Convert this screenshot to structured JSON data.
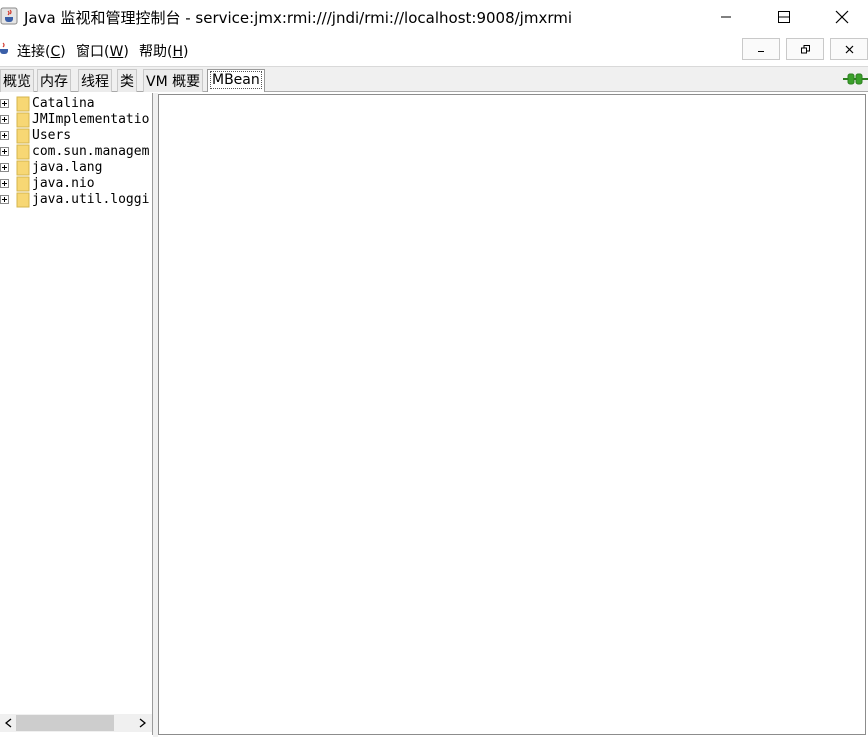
{
  "window": {
    "title": "Java 监视和管理控制台 - service:jmx:rmi:///jndi/rmi://localhost:9008/jmxrmi",
    "app_icon": "java-cup-icon",
    "controls": [
      "minimize-icon",
      "maximize-icon",
      "close-icon"
    ]
  },
  "menubar": {
    "items": [
      {
        "label": "连接(C)",
        "text": "连接(",
        "mnemonic": "C",
        "close": ")"
      },
      {
        "label": "窗口(W)",
        "text": "窗口(",
        "mnemonic": "W",
        "close": ")"
      },
      {
        "label": "帮助(H)",
        "text": "帮助(",
        "mnemonic": "H",
        "close": ")"
      }
    ],
    "mdi_controls": [
      "mdi-minimize-icon",
      "mdi-restore-icon",
      "mdi-close-icon"
    ]
  },
  "tabs": {
    "items": [
      "概览",
      "内存",
      "线程",
      "类",
      "VM 概要",
      "MBean"
    ],
    "selected": "MBean"
  },
  "connection_icon": "connected-plug-icon",
  "tree": {
    "nodes": [
      "Catalina",
      "JMImplementatio",
      "Users",
      "com.sun.managem",
      "java.lang",
      "java.nio",
      "java.util.loggi"
    ]
  },
  "colors": {
    "folder": "#f7d774",
    "connection": "#3aa02a"
  }
}
